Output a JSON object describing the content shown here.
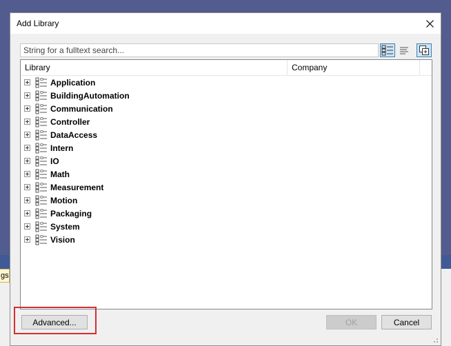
{
  "background": {
    "tab_text": "gs"
  },
  "dialog": {
    "title": "Add Library",
    "search_placeholder": "String for a fulltext search...",
    "columns": [
      "Library",
      "Company"
    ],
    "libraries": [
      "Application",
      "BuildingAutomation",
      "Communication",
      "Controller",
      "DataAccess",
      "Intern",
      "IO",
      "Math",
      "Measurement",
      "Motion",
      "Packaging",
      "System",
      "Vision"
    ],
    "buttons": {
      "advanced": "Advanced...",
      "ok": "OK",
      "cancel": "Cancel"
    },
    "icons": {
      "close": "close-icon",
      "view_categories": "category-view-icon",
      "view_list": "list-view-icon",
      "view_third": "expand-all-icon",
      "expander": "plus-box-icon",
      "library": "library-tree-icon"
    },
    "colors": {
      "highlight": "#d32f2f",
      "selected_button": "#cce4f7",
      "selected_border": "#3c7fb1"
    }
  }
}
